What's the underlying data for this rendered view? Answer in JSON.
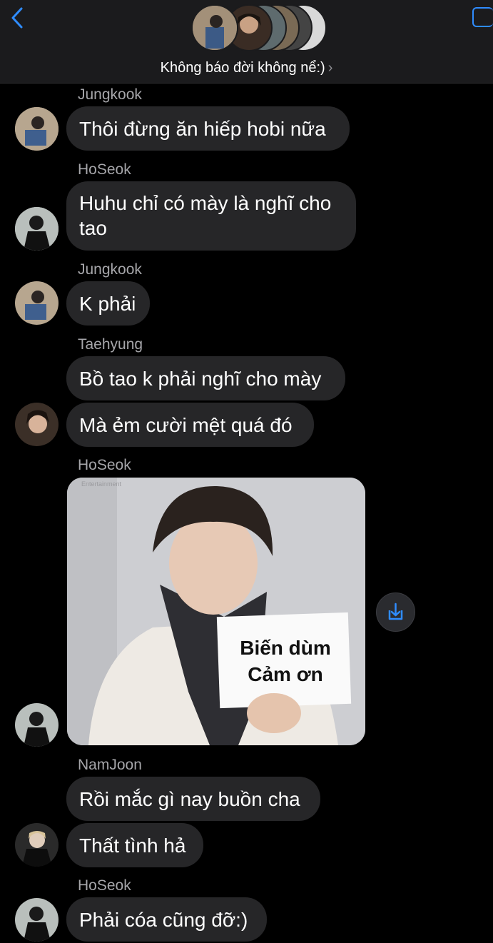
{
  "header": {
    "group_name": "Không báo đời không nể:)",
    "chevron": "›",
    "back_icon": "chevron-left-icon",
    "video_icon": "video-call-icon",
    "accent": "#2f8cff"
  },
  "messages": [
    {
      "sender": "Jungkook",
      "text": "Thôi đừng ăn hiếp hobi nữa"
    },
    {
      "sender": "HoSeok",
      "text_line1": "Huhu chỉ có mày là nghĩ cho",
      "text_line2": "tao"
    },
    {
      "sender": "Jungkook",
      "text": "K phải"
    },
    {
      "sender": "Taehyung",
      "text": "Bồ tao k phải nghĩ cho mày",
      "text2": "Mà ẻm cười mệt quá đó"
    },
    {
      "sender": "HoSeok",
      "image_sign_line1": "Biến dùm",
      "image_sign_line2": "Cảm ơn",
      "image_watermark": "Entertainment"
    },
    {
      "sender": "NamJoon",
      "text": "Rồi mắc gì nay buồn cha",
      "text2": "Thất tình hả"
    },
    {
      "sender": "HoSeok",
      "text": "Phải cóa cũng đỡ:)"
    }
  ],
  "colors": {
    "bubble": "#262628",
    "sender_name": "#a6a6aa",
    "header_bg": "#1b1b1d"
  }
}
